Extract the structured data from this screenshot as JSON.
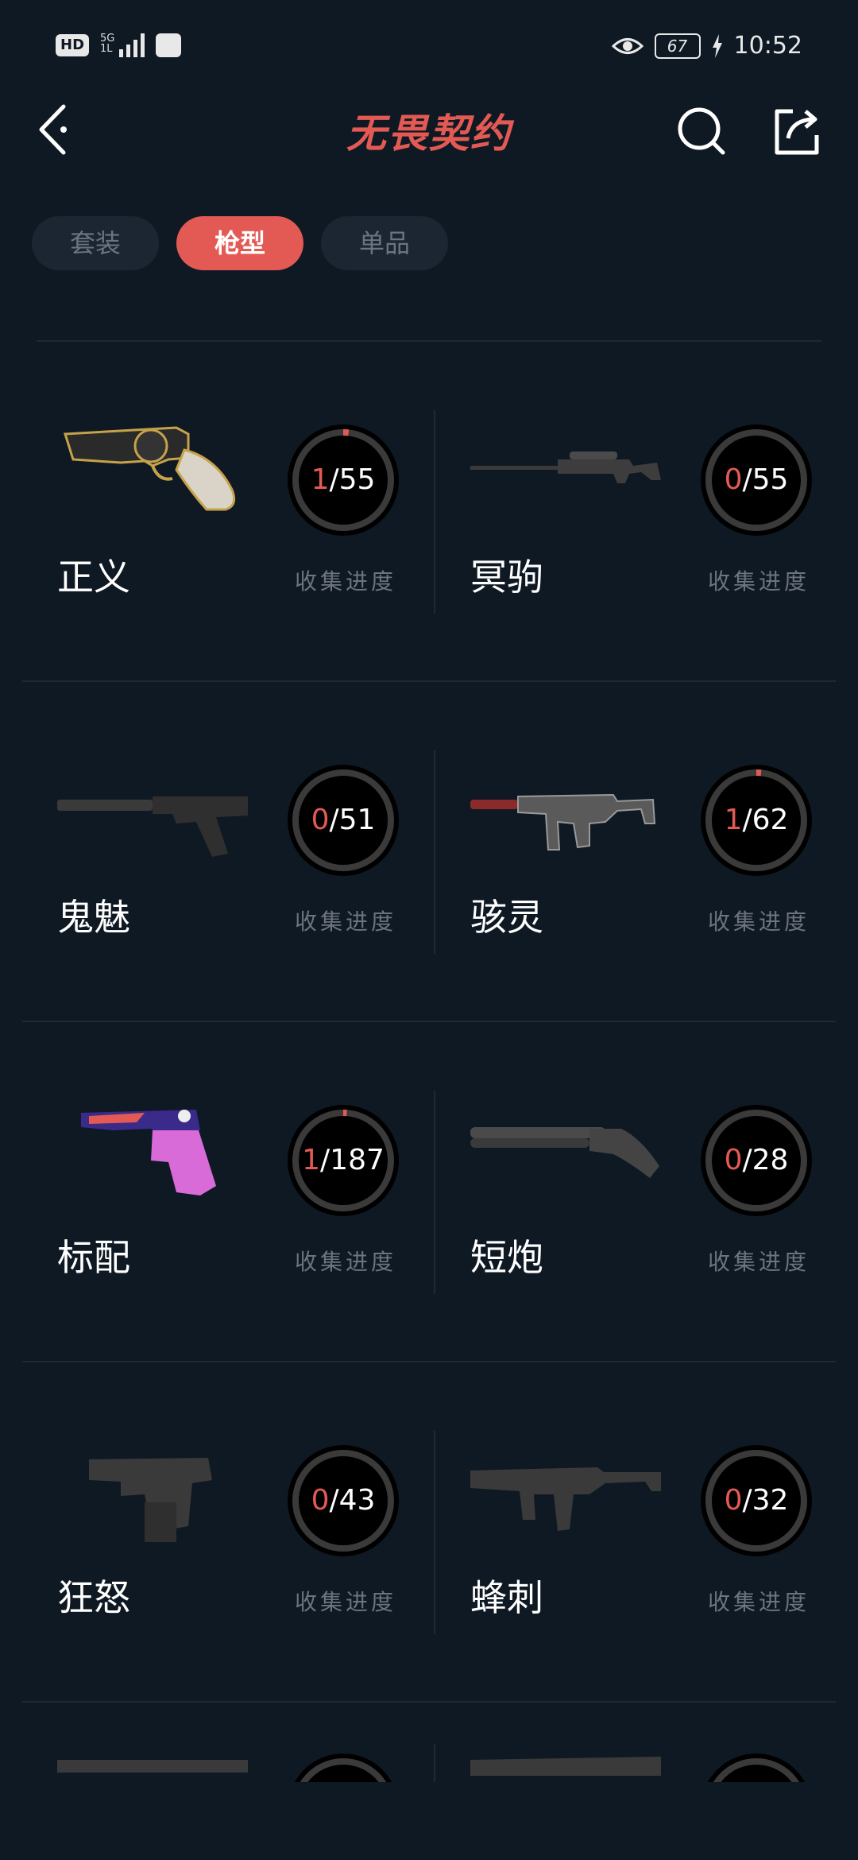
{
  "status_bar": {
    "hd": "HD",
    "network": "5G",
    "network_sub": "1L",
    "battery": "67",
    "time": "10:52"
  },
  "header": {
    "title": "无畏契约"
  },
  "tabs": [
    {
      "label": "套装",
      "active": false
    },
    {
      "label": "枪型",
      "active": true
    },
    {
      "label": "单品",
      "active": false
    }
  ],
  "progress_label": "收集进度",
  "colors": {
    "background": "#0f1923",
    "accent": "#e35a55",
    "muted_text": "#6b7480",
    "divider": "#1e2935"
  },
  "weapons": [
    {
      "name": "正义",
      "collected": "1",
      "total": "/55",
      "progress": 0.018,
      "icon": "revolver-skin"
    },
    {
      "name": "冥驹",
      "collected": "0",
      "total": "/55",
      "progress": 0.0,
      "icon": "sniper-rifle"
    },
    {
      "name": "鬼魅",
      "collected": "0",
      "total": "/51",
      "progress": 0.0,
      "icon": "silenced-pistol"
    },
    {
      "name": "骇灵",
      "collected": "1",
      "total": "/62",
      "progress": 0.016,
      "icon": "smg-skin"
    },
    {
      "name": "标配",
      "collected": "1",
      "total": "/187",
      "progress": 0.005,
      "icon": "pistol-skin"
    },
    {
      "name": "短炮",
      "collected": "0",
      "total": "/28",
      "progress": 0.0,
      "icon": "sawed-off-shotgun"
    },
    {
      "name": "狂怒",
      "collected": "0",
      "total": "/43",
      "progress": 0.0,
      "icon": "machine-pistol"
    },
    {
      "name": "蜂刺",
      "collected": "0",
      "total": "/32",
      "progress": 0.0,
      "icon": "smg"
    }
  ]
}
